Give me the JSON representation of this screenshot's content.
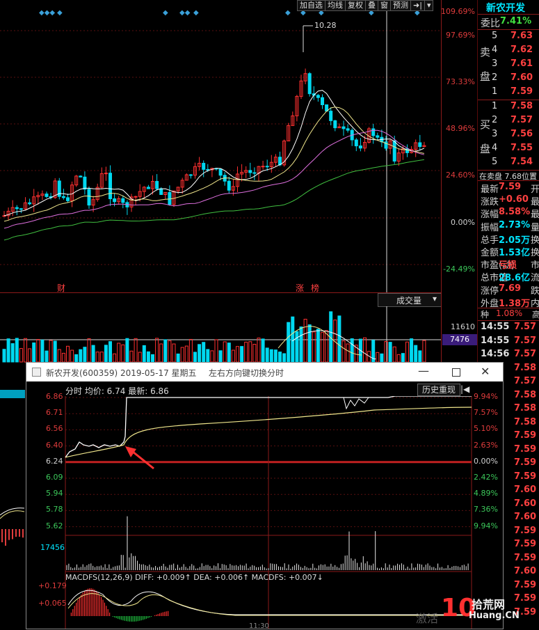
{
  "toolbar": {
    "items": [
      "加自选",
      "均线",
      "复权",
      "叠",
      "窗",
      "预测"
    ],
    "nav_icon": "arrow-right-bar-icon",
    "menu_icon": "caret-down-icon"
  },
  "main_chart": {
    "axis_labels": [
      "109.69%",
      "97.69%",
      "73.33%",
      "48.96%",
      "24.60%",
      "0.00%",
      "-24.49%"
    ],
    "peak_label": "10.28",
    "event_markers": [
      "财",
      "涨",
      "榜"
    ],
    "volume_selector": "成交量",
    "volume_axis_top": "11610",
    "volume_highlight": "7476",
    "lower_axis_value": "17456"
  },
  "quote_panel": {
    "stock_name": "新农开发",
    "webi_label": "委比",
    "webi_value": "7.41%",
    "sell_label_top": "卖",
    "sell_label_bottom": "盘",
    "buy_label_top": "买",
    "buy_label_bottom": "盘",
    "sell_levels": [
      {
        "level": "5",
        "price": "7.63"
      },
      {
        "level": "4",
        "price": "7.62"
      },
      {
        "level": "3",
        "price": "7.61"
      },
      {
        "level": "2",
        "price": "7.60"
      },
      {
        "level": "1",
        "price": "7.59"
      }
    ],
    "buy_levels": [
      {
        "level": "1",
        "price": "7.58"
      },
      {
        "level": "2",
        "price": "7.57"
      },
      {
        "level": "3",
        "price": "7.56"
      },
      {
        "level": "4",
        "price": "7.55"
      },
      {
        "level": "5",
        "price": "7.54"
      }
    ],
    "pending_text": "在卖盘 7.68位置",
    "stats": [
      {
        "label": "最新",
        "value": "7.59",
        "tail": "开"
      },
      {
        "label": "涨跌",
        "value": "+0.60",
        "tail": "最"
      },
      {
        "label": "涨幅",
        "value": "8.58%",
        "tail": "最"
      },
      {
        "label": "振幅",
        "value": "2.73%",
        "tail": "量"
      },
      {
        "label": "总手",
        "value": "2.05万",
        "tail": "换"
      },
      {
        "label": "金额",
        "value": "1.53亿",
        "tail": "换"
      },
      {
        "label": "市盈(动)",
        "value": "亏损",
        "tail": "市"
      },
      {
        "label": "总市值",
        "value": "28.6亿",
        "tail": "流"
      },
      {
        "label": "涨停",
        "value": "7.69",
        "tail": "跌"
      },
      {
        "label": "外盘",
        "value": "1.38万",
        "tail": "内"
      }
    ],
    "ticker_header_label": "种",
    "ticker_header_value": "1.08%",
    "ticker_header_tail": "高",
    "ticks": [
      {
        "time": "14:55",
        "price": "7.57"
      },
      {
        "time": "14:55",
        "price": "7.57"
      },
      {
        "time": "14:56",
        "price": "7.57"
      },
      {
        "time": "",
        "price": "7.58"
      },
      {
        "time": "",
        "price": "7.57"
      },
      {
        "time": "",
        "price": "7.58"
      },
      {
        "time": "",
        "price": "7.58"
      },
      {
        "time": "",
        "price": "7.58"
      },
      {
        "time": "",
        "price": "7.59"
      },
      {
        "time": "",
        "price": "7.59"
      },
      {
        "time": "",
        "price": "7.59"
      },
      {
        "time": "",
        "price": "7.59"
      },
      {
        "time": "",
        "price": "7.60"
      },
      {
        "time": "",
        "price": "7.60"
      },
      {
        "time": "",
        "price": "7.60"
      },
      {
        "time": "",
        "price": "7.59"
      },
      {
        "time": "",
        "price": "7.59"
      },
      {
        "time": "",
        "price": "7.59"
      },
      {
        "time": "",
        "price": "7.60"
      },
      {
        "time": "",
        "price": "7.59"
      },
      {
        "time": "",
        "price": "7.59"
      },
      {
        "time": "",
        "price": "7.59"
      }
    ]
  },
  "popup": {
    "title": "新农开发(600359) 2019-05-17 星期五",
    "hint": "左右方向键切换分时",
    "header_text": "分时 均价: 6.74 最新: 6.86",
    "history_button": "历史重现",
    "price_axis_left": [
      "6.86",
      "6.71",
      "6.56",
      "6.40",
      "6.24",
      "6.09",
      "5.94",
      "5.78",
      "5.62"
    ],
    "pct_axis_right": [
      "9.94%",
      "7.57%",
      "5.10%",
      "2.63%",
      "0.00%",
      "2.42%",
      "4.89%",
      "7.36%",
      "9.94%"
    ],
    "macd_text": "MACDFS(12,26,9) DIFF: +0.009↑ DEA: +0.006↑ MACDFS: +0.007↓",
    "macd_axis": [
      "+0.179",
      "+0.065"
    ],
    "macd_bottom_label": "11:30",
    "watermark_left": "激活",
    "watermark_brand": "拾荒网",
    "watermark_url": "Huang.CN",
    "watermark_num": "10"
  },
  "colors": {
    "up": "#ff4040",
    "down": "#00e5ff",
    "ma_yellow": "#f0e68c",
    "ma_pink": "#e070e0",
    "ma_green": "#40c040",
    "axis_red": "#e03c3c"
  }
}
